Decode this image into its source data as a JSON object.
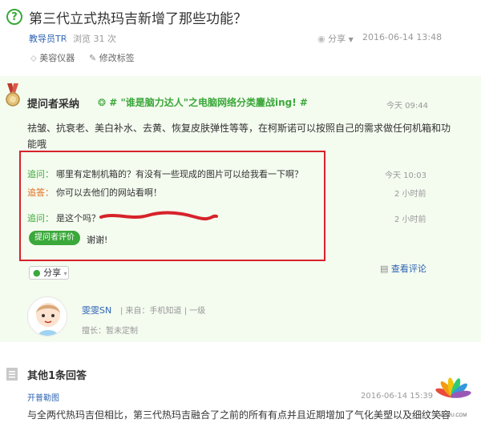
{
  "question": {
    "title": "第三代立式热玛吉新增了那些功能？",
    "author": "教导员TR",
    "separator": "|",
    "views": "浏览 31 次",
    "share_label": "分享",
    "date": "2016-06-14 13:48",
    "tags": [
      "美容仪器",
      "修改标签"
    ]
  },
  "best_answer": {
    "label": "提问者采纳",
    "activity": "# \"谁是脑力达人\"之电脑网络分类鏖战ing! #",
    "time": "今天 09:44",
    "body": "祛皱、抗衰老、美白补水、去黄、恢复皮肤弹性等等，在柯斯诺可以按照自己的需求做任何机箱和功能哦",
    "followups": [
      {
        "label": "追问：",
        "text": "哪里有定制机箱的？有没有一些现成的图片可以给我看一下啊？",
        "time": "今天 10:03"
      },
      {
        "label": "追答：",
        "text": "你可以去他们的网站看啊！",
        "time": "2 小时前"
      },
      {
        "label": "追问：",
        "text": "是这个吗？",
        "time": "2 小时前"
      }
    ],
    "eval_button": "提问者评价",
    "thanks": "谢谢!",
    "share_button": "分享",
    "view_comments": "查看评论"
  },
  "answerer": {
    "name": "雯雯SN",
    "source": "| 来自：手机知道 | 一级",
    "skill": "擅长：暂未定制"
  },
  "other_answers": {
    "title": "其他1条回答",
    "author": "开普勒图",
    "date": "2016-06-14 15:39",
    "body": "与全两代热玛吉但相比，第三代热玛吉融合了之前的所有有点并且近期增加了气化美塑以及细纹笑容"
  },
  "watermark": "MEIPU.COM",
  "colors": {
    "accent_green": "#3aa83a",
    "link_blue": "#2d64b3",
    "reply_orange": "#e46b1b",
    "highlight_red": "#d7222a",
    "best_bg": "#f4fbef"
  }
}
